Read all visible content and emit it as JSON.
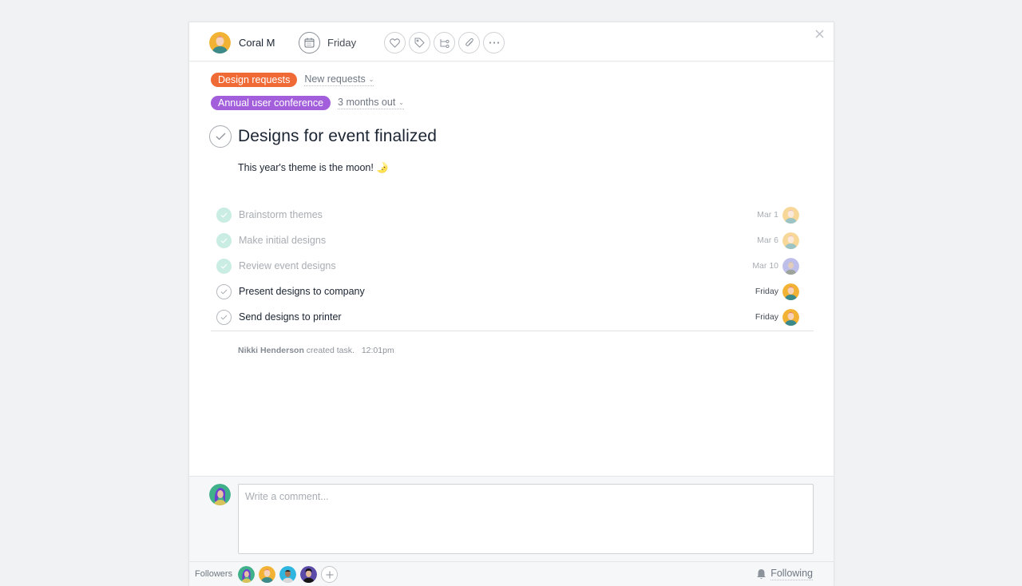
{
  "header": {
    "assignee": {
      "name": "Coral M",
      "avatar": "avatar-coral"
    },
    "due_date": {
      "label": "Friday",
      "icon": "calendar-icon"
    },
    "actions": [
      {
        "name": "like-button",
        "icon": "heart-icon"
      },
      {
        "name": "tags-button",
        "icon": "tag-icon"
      },
      {
        "name": "subtasks-button",
        "icon": "subtask-icon"
      },
      {
        "name": "attach-button",
        "icon": "paperclip-icon"
      },
      {
        "name": "more-button",
        "icon": "more-icon"
      }
    ],
    "close_icon": "close-icon"
  },
  "projects": [
    {
      "name": "Design requests",
      "color": "#f06a35",
      "section": "New requests"
    },
    {
      "name": "Annual user conference",
      "color": "#a35fdb",
      "section": "3 months out"
    }
  ],
  "task": {
    "title": "Designs for event finalized",
    "completed": false,
    "description": "This year's theme is the moon! 🌛"
  },
  "subtasks": [
    {
      "name": "Brainstorm themes",
      "due": "Mar 1",
      "completed": true,
      "assignee": "coral"
    },
    {
      "name": "Make initial designs",
      "due": "Mar 6",
      "completed": true,
      "assignee": "coral"
    },
    {
      "name": "Review event designs",
      "due": "Mar 10",
      "completed": true,
      "assignee": "man"
    },
    {
      "name": "Present designs to company",
      "due": "Friday",
      "completed": false,
      "assignee": "coral"
    },
    {
      "name": "Send designs to printer",
      "due": "Friday",
      "completed": false,
      "assignee": "coral"
    }
  ],
  "activity": {
    "author": "Nikki Henderson",
    "action": "created task.",
    "time": "12:01pm"
  },
  "comment": {
    "placeholder": "Write a comment...",
    "value": ""
  },
  "followers": {
    "label": "Followers",
    "members": [
      "nikki",
      "coral",
      "man-blue",
      "man-dark"
    ],
    "add_icon": "plus-icon"
  },
  "following": {
    "label": "Following",
    "icon": "bell-icon"
  },
  "colors": {
    "completed_check": "#c9ede3",
    "pane_background": "#ffffff",
    "page_background": "#f1f2f4"
  }
}
